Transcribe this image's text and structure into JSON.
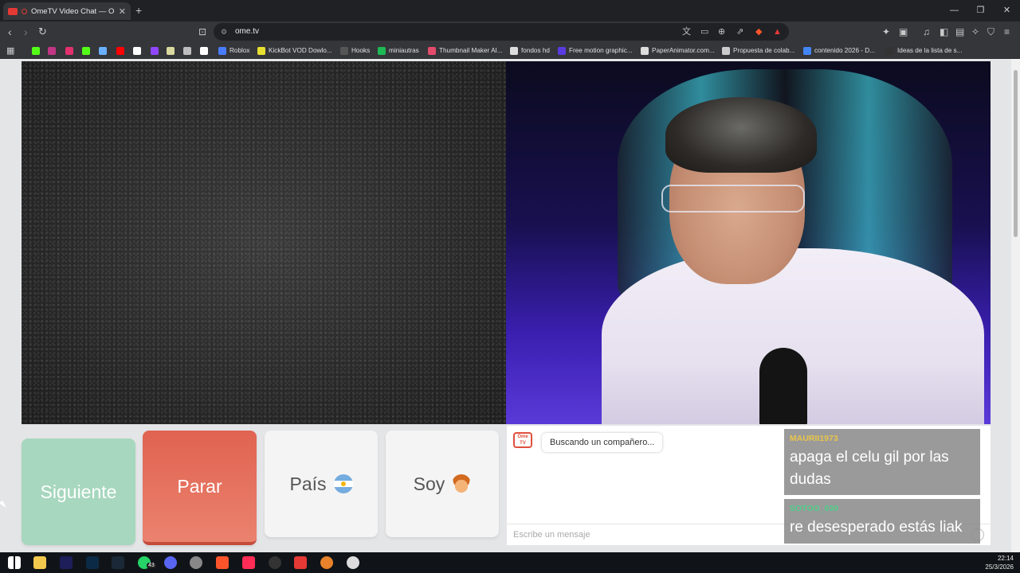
{
  "browser": {
    "tab_title": "OmeTV Video Chat — Omeg",
    "new_tab": "+",
    "close_tab": "✕",
    "url": "ome.tv",
    "window_controls": [
      "—",
      "❐",
      "✕"
    ]
  },
  "bookmarks": [
    {
      "label": "",
      "color": "#53fc18"
    },
    {
      "label": "",
      "color": "#c13584"
    },
    {
      "label": "",
      "color": "#e1306c"
    },
    {
      "label": "",
      "color": "#53fc18"
    },
    {
      "label": "",
      "color": "#6ab0ff"
    },
    {
      "label": "",
      "color": "#ff0000"
    },
    {
      "label": "",
      "color": "#ffffff"
    },
    {
      "label": "",
      "color": "#9146ff"
    },
    {
      "label": "",
      "color": "#d9d9a0"
    },
    {
      "label": "",
      "color": "#bdbdbd"
    },
    {
      "label": "",
      "color": "#ffffff"
    },
    {
      "label": "Roblox",
      "color": "#4a7cff"
    },
    {
      "label": "KickBot VOD Dowlo...",
      "color": "#e8e030"
    },
    {
      "label": "Hooks",
      "color": "#555555"
    },
    {
      "label": "miniautras",
      "color": "#1db954"
    },
    {
      "label": "Thumbnail Maker AI...",
      "color": "#e24b6b"
    },
    {
      "label": "fondos hd",
      "color": "#dddddd"
    },
    {
      "label": "Free motion graphic...",
      "color": "#5a3be0"
    },
    {
      "label": "PaperAnimator.com...",
      "color": "#dddddd"
    },
    {
      "label": "Propuesta de colab...",
      "color": "#cccccc"
    },
    {
      "label": "contenido 2026 - D...",
      "color": "#4285f4"
    },
    {
      "label": "Ideas de la lista de s...",
      "color": "#333333"
    }
  ],
  "controls": {
    "next": "Siguiente",
    "stop": "Parar",
    "country": "País",
    "gender": "Soy"
  },
  "chat": {
    "logo": "Ome TV",
    "status": "Buscando un compañero...",
    "input_placeholder": "Escribe un mensaje"
  },
  "stream_chat": [
    {
      "user": "MAURII1973",
      "text": "apaga el celu gil por las dudas"
    },
    {
      "user": "SOTOO_030",
      "text": "re desesperado estás liak"
    }
  ],
  "taskbar": {
    "time": "22:14",
    "date": "25/3/2026",
    "whatsapp_badge": "43"
  },
  "colors": {
    "next": "#a7d7be",
    "stop": "#e06350",
    "page_bg": "#e4e5e7"
  }
}
